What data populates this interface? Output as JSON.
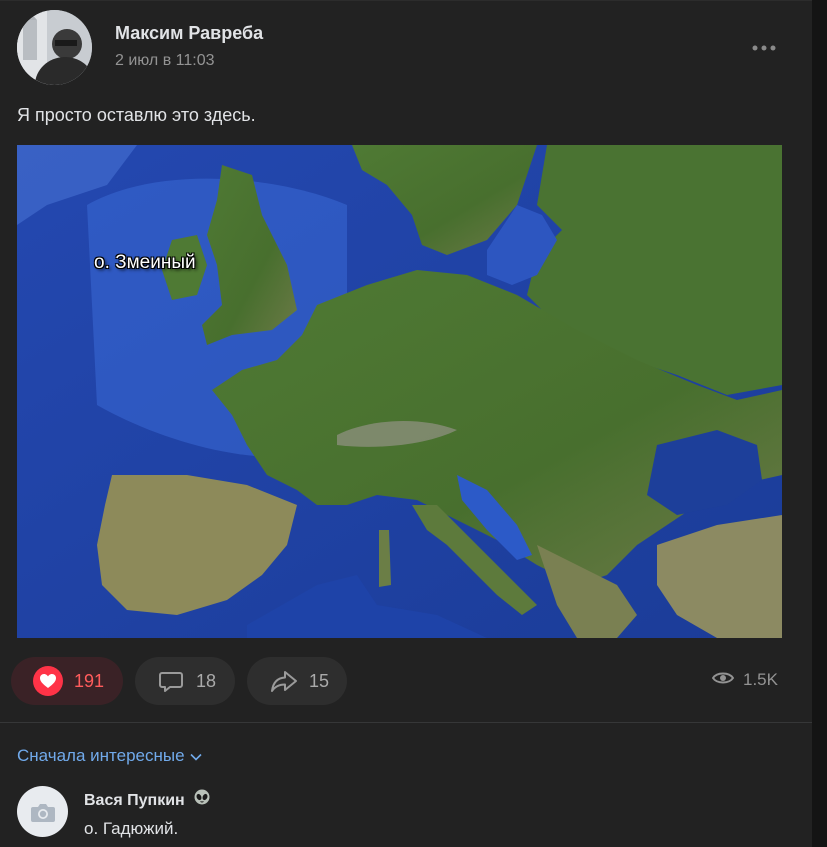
{
  "post": {
    "author_name": "Максим Равреба",
    "date": "2 июл в 11:03",
    "text": "Я просто оставлю это здесь.",
    "image": {
      "map_label": "о. Змеиный"
    }
  },
  "actions": {
    "likes": "191",
    "comments": "18",
    "shares": "15",
    "views": "1.5K"
  },
  "comments_section": {
    "sort_label": "Сначала интересные",
    "items": [
      {
        "author": "Вася Пупкин",
        "text": "о. Гадюжий."
      }
    ]
  },
  "colors": {
    "like_accent": "#ff5c5c",
    "link": "#71aaeb",
    "background": "#222222"
  }
}
